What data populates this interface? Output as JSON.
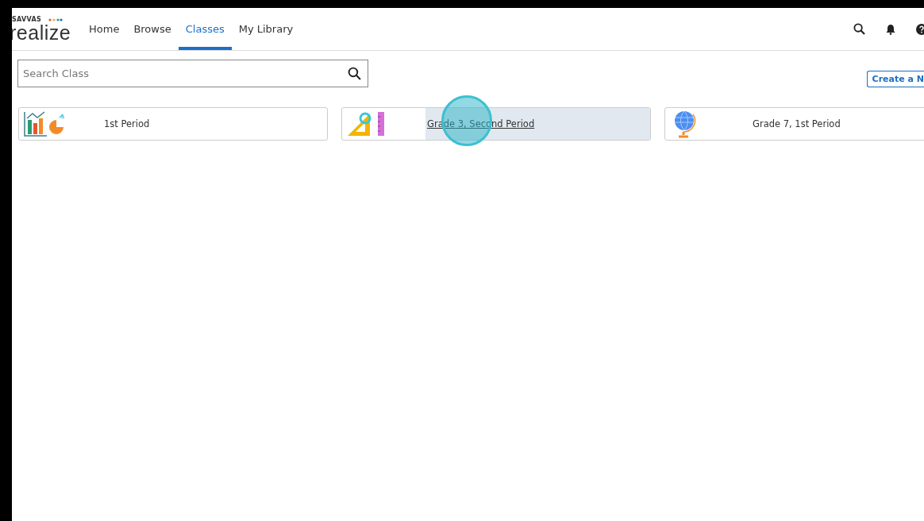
{
  "logo": {
    "brand": "SAVVAS",
    "name": "realize"
  },
  "nav": [
    {
      "label": "Home",
      "selected": false
    },
    {
      "label": "Browse",
      "selected": false
    },
    {
      "label": "Classes",
      "selected": true
    },
    {
      "label": "My Library",
      "selected": false
    }
  ],
  "search": {
    "placeholder": "Search Class"
  },
  "create_button": "Create a N",
  "classes": [
    {
      "name": "1st Period",
      "kind": "chart",
      "hovered": false
    },
    {
      "name": "Grade 3, Second Period",
      "kind": "ruler",
      "hovered": true
    },
    {
      "name": "Grade 7, 1st Period",
      "kind": "globe",
      "hovered": false
    }
  ]
}
